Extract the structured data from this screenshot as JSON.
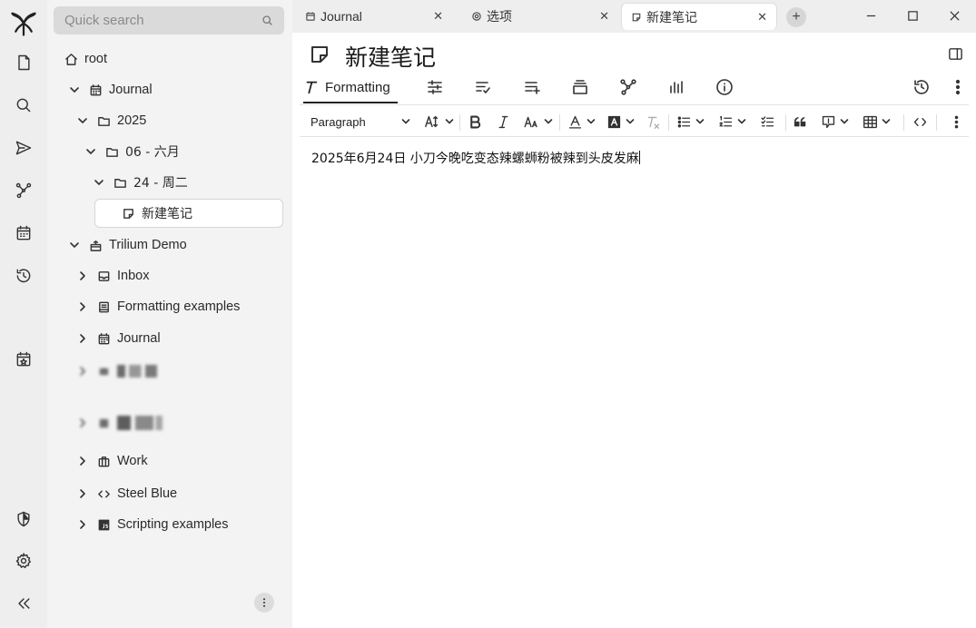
{
  "search": {
    "placeholder": "Quick search"
  },
  "tree": {
    "items": [
      {
        "label": "root"
      },
      {
        "label": "Journal"
      },
      {
        "label": "2025"
      },
      {
        "label": "06 - 六月"
      },
      {
        "label": "24 - 周二"
      },
      {
        "label": "新建笔记"
      },
      {
        "label": "Trilium Demo"
      },
      {
        "label": "Inbox"
      },
      {
        "label": "Formatting examples"
      },
      {
        "label": "Journal"
      },
      {
        "label": "Work"
      },
      {
        "label": "Steel Blue"
      },
      {
        "label": "Scripting examples"
      }
    ]
  },
  "tabs": [
    {
      "label": "Journal",
      "close": "✕"
    },
    {
      "label": "选项",
      "close": "✕"
    },
    {
      "label": "新建笔记",
      "close": "✕"
    }
  ],
  "new_tab": "+",
  "note": {
    "title": "新建笔记",
    "ribbon": {
      "formatting_label": "Formatting"
    },
    "toolbar": {
      "block_type": "Paragraph"
    },
    "content": "2025年6月24日 小刀今晚吃变态辣螺蛳粉被辣到头皮发麻"
  },
  "icons": {
    "launcher": [
      "app-logo-icon",
      "new-note-icon",
      "search-icon",
      "jump-to-icon",
      "note-map-icon",
      "calendar-icon",
      "history-icon",
      "today-icon",
      "protected-session-icon",
      "settings-icon",
      "collapse-icon"
    ]
  }
}
